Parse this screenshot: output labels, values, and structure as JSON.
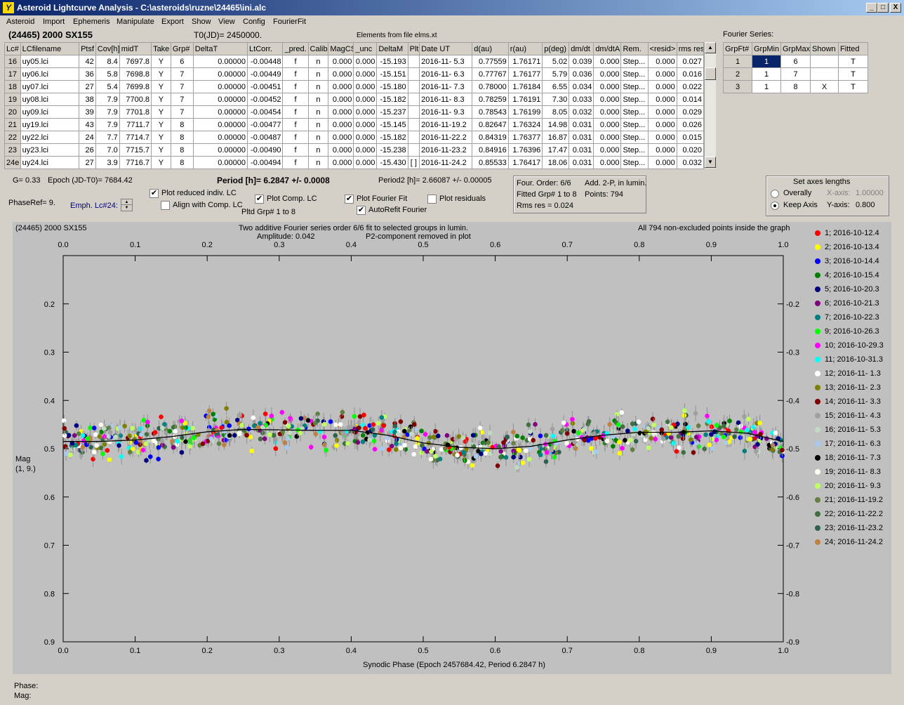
{
  "window": {
    "title": "Asteroid Lightcurve Analysis - C:\\asteroids\\ruzne\\24465\\ini.alc",
    "icon": "app-logo-icon",
    "minimize": "_",
    "maximize": "□",
    "close": "X"
  },
  "menu": [
    "Asteroid",
    "Import",
    "Ephemeris",
    "Manipulate",
    "Export",
    "Show",
    "View",
    "Config",
    "FourierFit"
  ],
  "header": {
    "asteroid": "(24465) 2000 SX155",
    "t0": "T0(JD)= 2450000.",
    "elements": "Elements from file elms.xt"
  },
  "lc_table": {
    "columns": [
      "Lc#",
      "LCfilename",
      "Ptsf",
      "Cov[h]",
      "midT",
      "Take",
      "Grp#",
      "DeltaT",
      "LtCorr.",
      "_pred.",
      "Calib.",
      "MagCS",
      "_unc",
      "DeltaM",
      "Plt",
      "Date UT",
      "d(au)",
      "r(au)",
      "p(deg)",
      "dm/dt",
      "dm/dtA",
      "Rem.",
      "<resid>",
      "rms res"
    ],
    "rows": [
      [
        "16",
        "uy05.lci",
        "42",
        "8.4",
        "7697.8",
        "Y",
        "6",
        "0.00000",
        "-0.00448",
        "f",
        "n",
        "0.000",
        "0.000",
        "-15.193",
        "",
        "2016-11- 5.3",
        "0.77559",
        "1.76171",
        "5.02",
        "0.039",
        "0.000",
        "Step...",
        "0.000",
        "0.027"
      ],
      [
        "17",
        "uy06.lci",
        "36",
        "5.8",
        "7698.8",
        "Y",
        "7",
        "0.00000",
        "-0.00449",
        "f",
        "n",
        "0.000",
        "0.000",
        "-15.151",
        "",
        "2016-11- 6.3",
        "0.77767",
        "1.76177",
        "5.79",
        "0.036",
        "0.000",
        "Step...",
        "0.000",
        "0.016"
      ],
      [
        "18",
        "uy07.lci",
        "27",
        "5.4",
        "7699.8",
        "Y",
        "7",
        "0.00000",
        "-0.00451",
        "f",
        "n",
        "0.000",
        "0.000",
        "-15.180",
        "",
        "2016-11- 7.3",
        "0.78000",
        "1.76184",
        "6.55",
        "0.034",
        "0.000",
        "Step...",
        "0.000",
        "0.022"
      ],
      [
        "19",
        "uy08.lci",
        "38",
        "7.9",
        "7700.8",
        "Y",
        "7",
        "0.00000",
        "-0.00452",
        "f",
        "n",
        "0.000",
        "0.000",
        "-15.182",
        "",
        "2016-11- 8.3",
        "0.78259",
        "1.76191",
        "7.30",
        "0.033",
        "0.000",
        "Step...",
        "0.000",
        "0.014"
      ],
      [
        "20",
        "uy09.lci",
        "39",
        "7.9",
        "7701.8",
        "Y",
        "7",
        "0.00000",
        "-0.00454",
        "f",
        "n",
        "0.000",
        "0.000",
        "-15.237",
        "",
        "2016-11- 9.3",
        "0.78543",
        "1.76199",
        "8.05",
        "0.032",
        "0.000",
        "Step...",
        "0.000",
        "0.029"
      ],
      [
        "21",
        "uy19.lci",
        "43",
        "7.9",
        "7711.7",
        "Y",
        "8",
        "0.00000",
        "-0.00477",
        "f",
        "n",
        "0.000",
        "0.000",
        "-15.145",
        "",
        "2016-11-19.2",
        "0.82647",
        "1.76324",
        "14.98",
        "0.031",
        "0.000",
        "Step...",
        "0.000",
        "0.026"
      ],
      [
        "22",
        "uy22.lci",
        "24",
        "7.7",
        "7714.7",
        "Y",
        "8",
        "0.00000",
        "-0.00487",
        "f",
        "n",
        "0.000",
        "0.000",
        "-15.182",
        "",
        "2016-11-22.2",
        "0.84319",
        "1.76377",
        "16.87",
        "0.031",
        "0.000",
        "Step...",
        "0.000",
        "0.015"
      ],
      [
        "23",
        "uy23.lci",
        "26",
        "7.0",
        "7715.7",
        "Y",
        "8",
        "0.00000",
        "-0.00490",
        "f",
        "n",
        "0.000",
        "0.000",
        "-15.238",
        "",
        "2016-11-23.2",
        "0.84916",
        "1.76396",
        "17.47",
        "0.031",
        "0.000",
        "Step...",
        "0.000",
        "0.020"
      ],
      [
        "24e",
        "uy24.lci",
        "27",
        "3.9",
        "7716.7",
        "Y",
        "8",
        "0.00000",
        "-0.00494",
        "f",
        "n",
        "0.000",
        "0.000",
        "-15.430",
        "[ ]",
        "2016-11-24.2",
        "0.85533",
        "1.76417",
        "18.06",
        "0.031",
        "0.000",
        "Step...",
        "0.000",
        "0.032"
      ]
    ]
  },
  "fourier_table": {
    "label": "Fourier Series:",
    "columns": [
      "GrpFt#",
      "GrpMin",
      "GrpMax",
      "Shown",
      "Fitted"
    ],
    "rows": [
      [
        "1",
        "1",
        "6",
        "",
        "T"
      ],
      [
        "2",
        "1",
        "7",
        "",
        "T"
      ],
      [
        "3",
        "1",
        "8",
        "X",
        "T"
      ]
    ]
  },
  "info": {
    "g": "G= 0.33",
    "epoch": "Epoch (JD-T0)= 7684.42",
    "period": "Period [h]= 6.2847 +/- 0.0008",
    "period2": "Period2 [h]= 2.66087 +/- 0.00005",
    "phaseref": "PhaseRef= 9.",
    "emph": "Emph. Lc#24:"
  },
  "checks": {
    "plot_reduced": {
      "label": "Plot reduced indiv. LC",
      "checked": true
    },
    "align": {
      "label": "Align with Comp. LC",
      "checked": false
    },
    "plot_comp": {
      "label": "Plot Comp. LC",
      "checked": true
    },
    "pltd": "Pltd Grp#  1   to    8",
    "plot_fourier": {
      "label": "Plot Fourier Fit",
      "checked": true
    },
    "autorefit": {
      "label": "AutoRefit Fourier",
      "checked": true
    },
    "plot_resid": {
      "label": "Plot residuals",
      "checked": false
    }
  },
  "fourbox": {
    "order": "Four. Order:  6/6",
    "add": "Add. 2-P, in lumin.",
    "fitted": "Fitted Grp# 1 to 8",
    "points": "Points: 794",
    "rms": "Rms res    = 0.024"
  },
  "axes_box": {
    "title": "Set axes lengths",
    "overall": "Overally",
    "keep": "Keep Axis",
    "xaxis_label": "X-axis:",
    "xaxis_val": "1.00000",
    "yaxis_label": "Y-axis:",
    "yaxis_val": "0.800"
  },
  "plot": {
    "object": "(24465) 2000 SX155",
    "title1": "Two additive Fourier series order 6/6 fit to selected groups in lumin.",
    "amplitude": "Amplitude: 0.042",
    "p2": "P2-component removed in plot",
    "points_note": "All 794 non-excluded points inside the graph",
    "xlabel": "Synodic Phase (Epoch 2457684.42, Period 6.2847 h)",
    "ylabel1": "Mag",
    "ylabel2": "(1, 9.)"
  },
  "chart_data": {
    "type": "scatter",
    "xlim": [
      0,
      1
    ],
    "ylim": [
      0.9,
      0.1
    ],
    "xticks": [
      "0.0",
      "0.1",
      "0.2",
      "0.3",
      "0.4",
      "0.5",
      "0.6",
      "0.7",
      "0.8",
      "0.9",
      "1.0"
    ],
    "yticks": [
      "0.2",
      "0.3",
      "0.4",
      "0.5",
      "0.6",
      "0.7",
      "0.8",
      "0.9"
    ],
    "ytick_values": [
      0.2,
      0.3,
      0.4,
      0.5,
      0.6,
      0.7,
      0.8,
      0.9
    ],
    "fit_curve": {
      "x": [
        0,
        0.05,
        0.1,
        0.15,
        0.2,
        0.25,
        0.3,
        0.35,
        0.4,
        0.45,
        0.5,
        0.55,
        0.6,
        0.65,
        0.7,
        0.75,
        0.8,
        0.85,
        0.9,
        0.95,
        1.0
      ],
      "y": [
        0.485,
        0.485,
        0.482,
        0.475,
        0.465,
        0.46,
        0.461,
        0.462,
        0.462,
        0.472,
        0.488,
        0.497,
        0.5,
        0.495,
        0.482,
        0.472,
        0.466,
        0.466,
        0.463,
        0.468,
        0.485
      ]
    },
    "series": [
      {
        "name": "1; 2016-10-12.4",
        "color": "#ff0000"
      },
      {
        "name": "2; 2016-10-13.4",
        "color": "#ffff00"
      },
      {
        "name": "3; 2016-10-14.4",
        "color": "#0000ff"
      },
      {
        "name": "4; 2016-10-15.4",
        "color": "#008000"
      },
      {
        "name": "5; 2016-10-20.3",
        "color": "#000080"
      },
      {
        "name": "6; 2016-10-21.3",
        "color": "#800080"
      },
      {
        "name": "7; 2016-10-22.3",
        "color": "#008080"
      },
      {
        "name": "9; 2016-10-26.3",
        "color": "#00ff00"
      },
      {
        "name": "10; 2016-10-29.3",
        "color": "#ff00ff"
      },
      {
        "name": "11; 2016-10-31.3",
        "color": "#00ffff"
      },
      {
        "name": "12; 2016-11- 1.3",
        "color": "#ffffff"
      },
      {
        "name": "13; 2016-11- 2.3",
        "color": "#808000"
      },
      {
        "name": "14; 2016-11- 3.3",
        "color": "#800000"
      },
      {
        "name": "15; 2016-11- 4.3",
        "color": "#a0a0a0"
      },
      {
        "name": "16; 2016-11- 5.3",
        "color": "#c0dcc0"
      },
      {
        "name": "17; 2016-11- 6.3",
        "color": "#a6caf0"
      },
      {
        "name": "18; 2016-11- 7.3",
        "color": "#000000"
      },
      {
        "name": "19; 2016-11- 8.3",
        "color": "#fffbf0"
      },
      {
        "name": "20; 2016-11- 9.3",
        "color": "#c0ff60"
      },
      {
        "name": "21; 2016-11-19.2",
        "color": "#608040"
      },
      {
        "name": "22; 2016-11-22.2",
        "color": "#407040"
      },
      {
        "name": "23; 2016-11-23.2",
        "color": "#306050"
      },
      {
        "name": "24; 2016-11-24.2",
        "color": "#c08040"
      }
    ]
  },
  "status": {
    "phase": "Phase:",
    "mag": "Mag:"
  }
}
